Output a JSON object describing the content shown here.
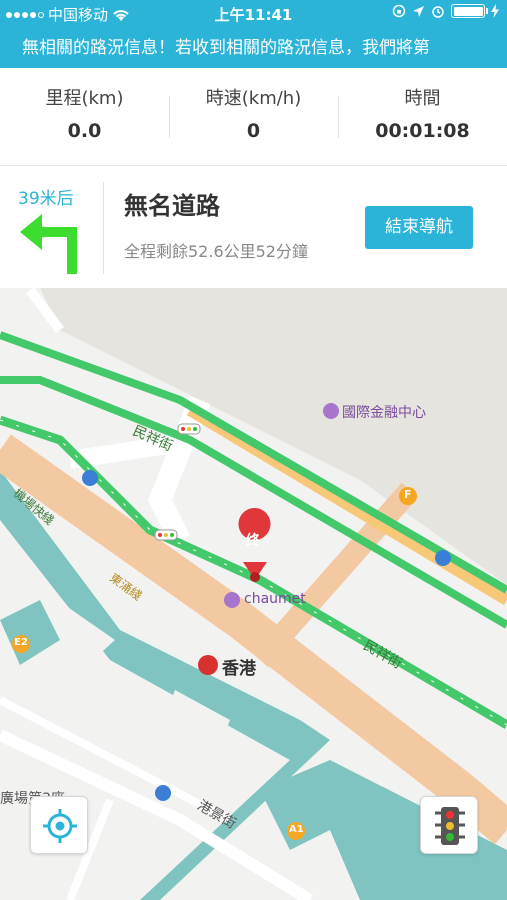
{
  "status_bar": {
    "carrier": "中国移动",
    "time": "上午11:41"
  },
  "marquee": {
    "text": "無相關的路況信息！若收到相關的路況信息，我們將第"
  },
  "stats": [
    {
      "label": "里程(km)",
      "value": "0.0"
    },
    {
      "label": "時速(km/h)",
      "value": "0"
    },
    {
      "label": "時間",
      "value": "00:01:08"
    }
  ],
  "nav": {
    "distance": "39米后",
    "road": "無名道路",
    "remaining": "全程剩餘52.6公里52分鐘",
    "end_button": "結束導航",
    "turn_icon": "turn-left-arrow-icon",
    "accent": "#2bb4d8",
    "arrow_color": "#3ddc2e"
  },
  "map": {
    "labels": {
      "ifc": "國際金融中心",
      "minxiang1": "民祥街",
      "minxiang2": "民祥街",
      "jichang": "機場快綫",
      "dongyong": "東涌綫",
      "chaumet": "chaumet",
      "hongkong": "香港",
      "gangjing": "港景街",
      "guangchang": "廣場第3座",
      "e2": "E2",
      "a1": "A1",
      "f": "F",
      "destination": "终"
    },
    "route_color": "#43c86a",
    "controls": {
      "locate": "locate-icon",
      "traffic": "traffic-light-icon"
    }
  }
}
